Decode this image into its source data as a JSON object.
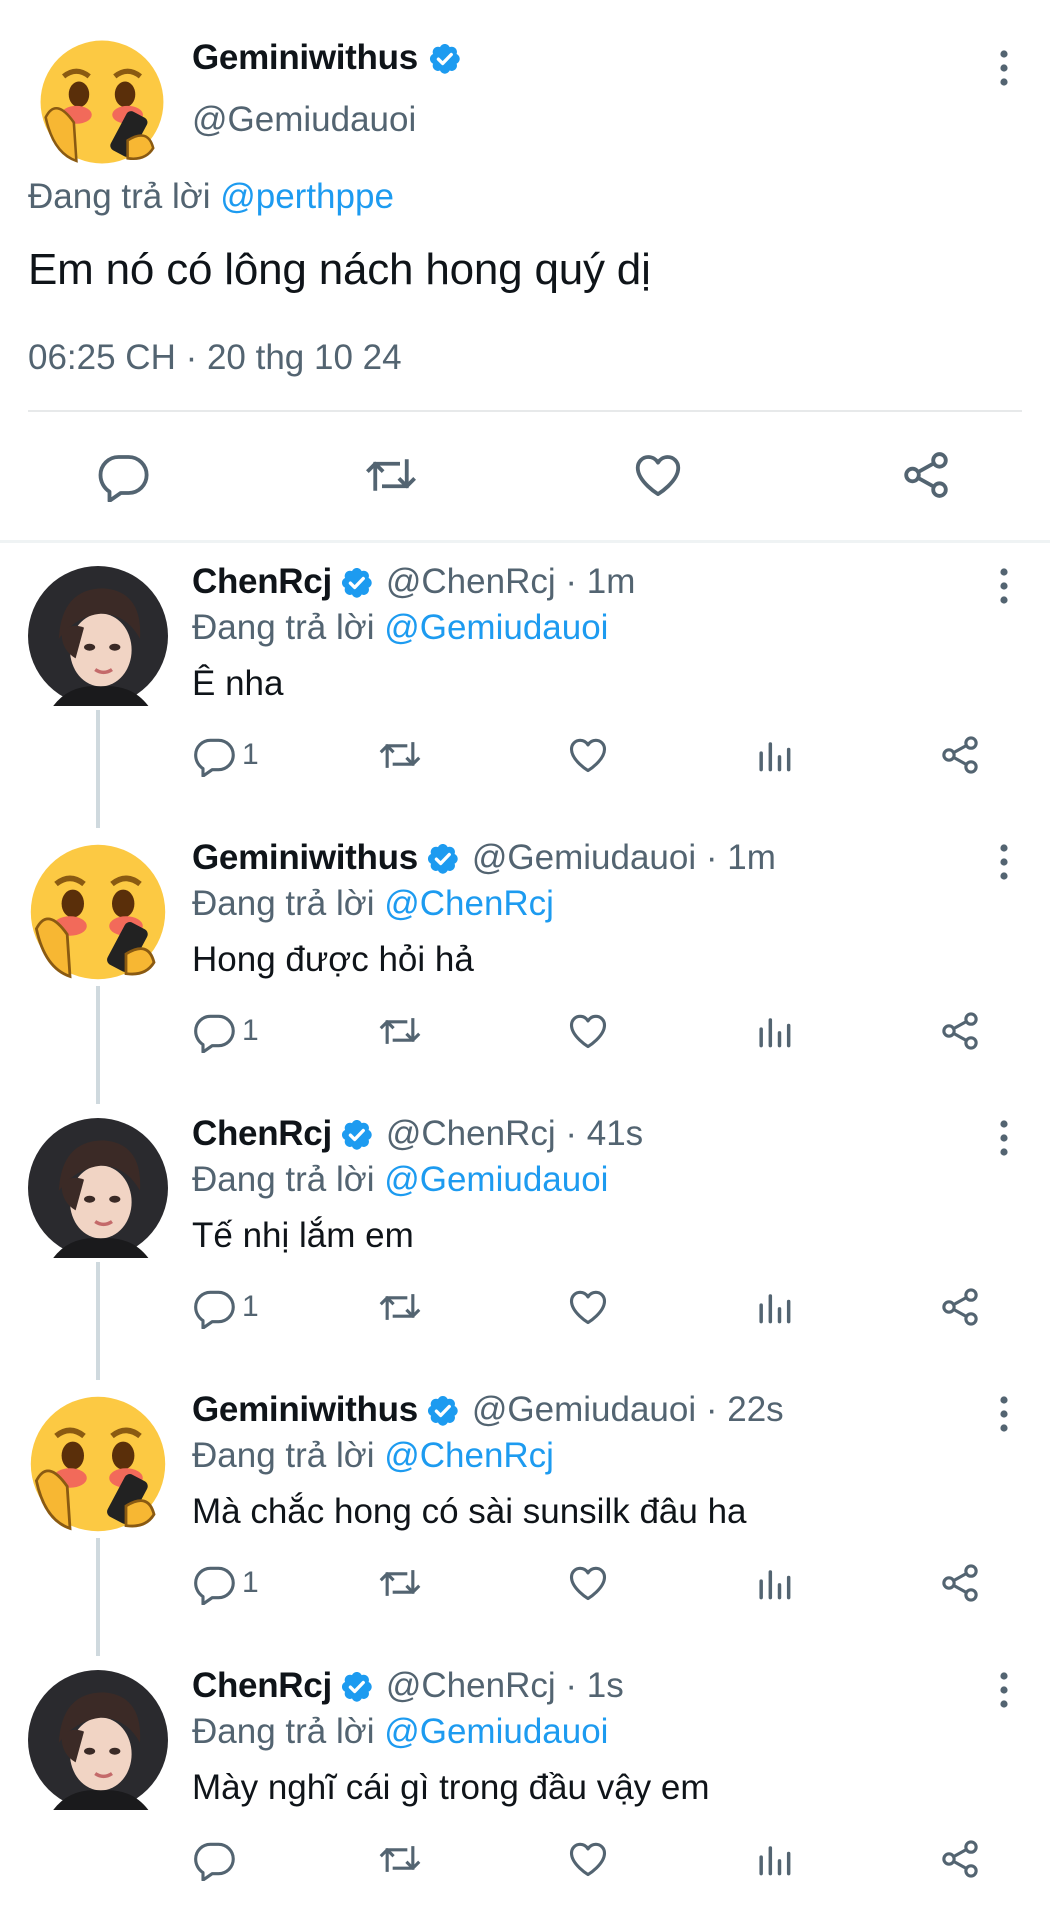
{
  "main_tweet": {
    "display_name": "Geminiwithus",
    "handle": "@Gemiudauoi",
    "replying_prefix": "Đang trả lời",
    "replying_to": "@perthppe",
    "text": "Em nó có lông nách hong quý dị",
    "timestamp": "06:25 CH · 20 thg 10 24"
  },
  "replies": [
    {
      "display_name": "ChenRcj",
      "meta": "@ChenRcj · 1m",
      "replying_prefix": "Đang trả lời",
      "replying_to": "@Gemiudauoi",
      "text": "Ê nha",
      "reply_count": "1"
    },
    {
      "display_name": "Geminiwithus",
      "meta": "@Gemiudauoi · 1m",
      "replying_prefix": "Đang trả lời",
      "replying_to": "@ChenRcj",
      "text": "Hong được hỏi hả",
      "reply_count": "1"
    },
    {
      "display_name": "ChenRcj",
      "meta": "@ChenRcj · 41s",
      "replying_prefix": "Đang trả lời",
      "replying_to": "@Gemiudauoi",
      "text": "Tế nhị lắm em",
      "reply_count": "1"
    },
    {
      "display_name": "Geminiwithus",
      "meta": "@Gemiudauoi · 22s",
      "replying_prefix": "Đang trả lời",
      "replying_to": "@ChenRcj",
      "text": "Mà chắc hong có sài sunsilk đâu ha",
      "reply_count": "1"
    },
    {
      "display_name": "ChenRcj",
      "meta": "@ChenRcj · 1s",
      "replying_prefix": "Đang trả lời",
      "replying_to": "@Gemiudauoi",
      "text": "Mày nghĩ cái gì trong đầu vậy em",
      "reply_count": ""
    }
  ],
  "colors": {
    "link": "#1d9bf0",
    "secondary_text": "#536471",
    "icon": "#536471",
    "verified": "#1d9bf0",
    "thread_line": "#cfd9de"
  },
  "icons": {
    "avatar_gemini": "blushing-emoji-avatar",
    "avatar_chen": "person-photo-avatar",
    "verified": "verified-badge-icon",
    "more": "more-vertical-icon",
    "reply": "reply-icon",
    "retweet": "retweet-icon",
    "like": "like-icon",
    "views": "views-icon",
    "share": "share-icon"
  }
}
